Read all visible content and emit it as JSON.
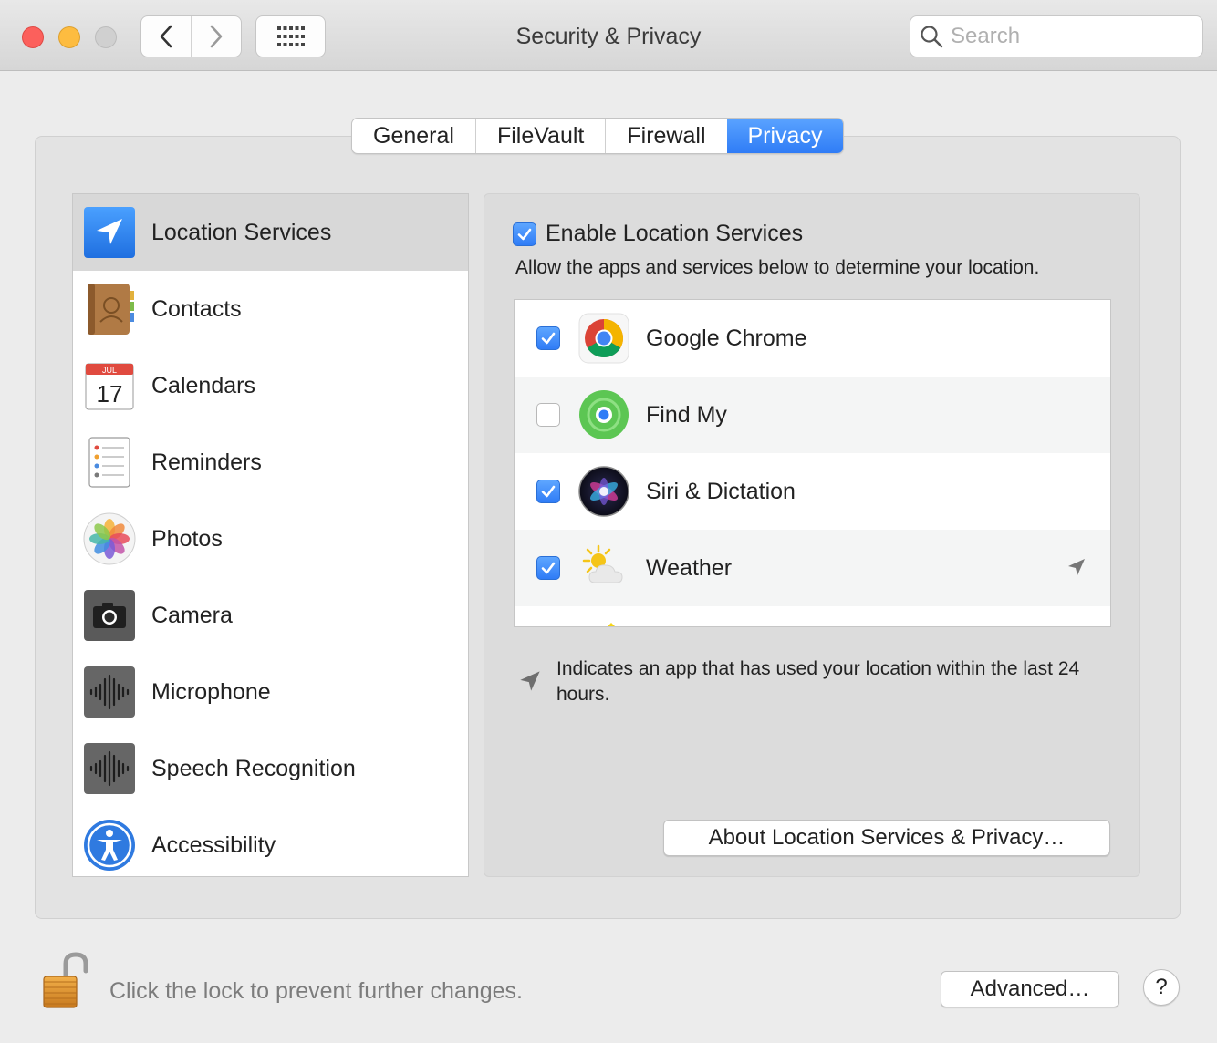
{
  "window": {
    "title": "Security & Privacy"
  },
  "search": {
    "placeholder": "Search"
  },
  "tabs": [
    {
      "label": "General",
      "active": false
    },
    {
      "label": "FileVault",
      "active": false
    },
    {
      "label": "Firewall",
      "active": false
    },
    {
      "label": "Privacy",
      "active": true
    }
  ],
  "categories": [
    {
      "label": "Location Services",
      "icon": "location-arrow-icon",
      "selected": true
    },
    {
      "label": "Contacts",
      "icon": "contacts-book-icon",
      "selected": false
    },
    {
      "label": "Calendars",
      "icon": "calendar-icon",
      "selected": false
    },
    {
      "label": "Reminders",
      "icon": "reminders-icon",
      "selected": false
    },
    {
      "label": "Photos",
      "icon": "photos-flower-icon",
      "selected": false
    },
    {
      "label": "Camera",
      "icon": "camera-icon",
      "selected": false
    },
    {
      "label": "Microphone",
      "icon": "microphone-waveform-icon",
      "selected": false
    },
    {
      "label": "Speech Recognition",
      "icon": "speech-waveform-icon",
      "selected": false
    },
    {
      "label": "Accessibility",
      "icon": "accessibility-icon",
      "selected": false
    }
  ],
  "calendar_icon": {
    "month": "JUL",
    "day": "17"
  },
  "location": {
    "enable_label": "Enable Location Services",
    "enabled": true,
    "description": "Allow the apps and services below to determine your location.",
    "apps": [
      {
        "name": "Google Chrome",
        "checked": true,
        "icon": "chrome-icon",
        "recent": false
      },
      {
        "name": "Find My",
        "checked": false,
        "icon": "find-my-icon",
        "recent": false
      },
      {
        "name": "Siri & Dictation",
        "checked": true,
        "icon": "siri-icon",
        "recent": false
      },
      {
        "name": "Weather",
        "checked": true,
        "icon": "weather-icon",
        "recent": true
      }
    ],
    "note": "Indicates an app that has used your location within the last 24 hours.",
    "about_button": "About Location Services & Privacy…"
  },
  "footer": {
    "lock_text": "Click the lock to prevent further changes.",
    "advanced_button": "Advanced…",
    "help_button": "?"
  },
  "colors": {
    "accent": "#2f7cf6",
    "selected_row": "#d8d8d8"
  }
}
